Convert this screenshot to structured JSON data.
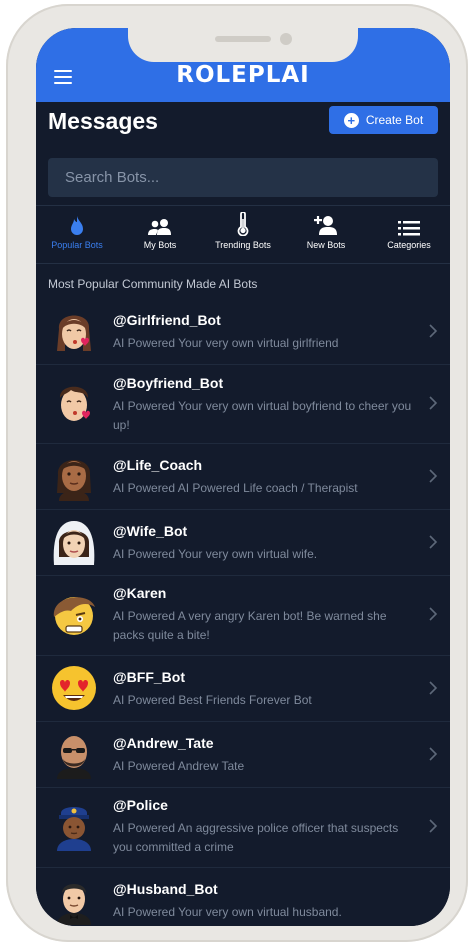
{
  "app": {
    "logo": "ROLEPLAI"
  },
  "header": {
    "title": "Messages",
    "create_label": "Create Bot"
  },
  "search": {
    "placeholder": "Search Bots..."
  },
  "tabs": [
    {
      "label": "Popular Bots",
      "icon": "flame-icon",
      "active": true
    },
    {
      "label": "My Bots",
      "icon": "users-icon",
      "active": false
    },
    {
      "label": "Trending Bots",
      "icon": "thermometer-icon",
      "active": false
    },
    {
      "label": "New Bots",
      "icon": "user-plus-icon",
      "active": false
    },
    {
      "label": "Categories",
      "icon": "list-icon",
      "active": false
    }
  ],
  "section_title": "Most Popular Community Made AI Bots",
  "bots": [
    {
      "name": "@Girlfriend_Bot",
      "description": "AI Powered Your very own virtual girlfriend",
      "avatar": "girl-kiss-emoji"
    },
    {
      "name": "@Boyfriend_Bot",
      "description": "AI Powered Your very own virtual boyfriend to cheer you up!",
      "avatar": "boy-kiss-emoji"
    },
    {
      "name": "@Life_Coach",
      "description": "AI Powered AI Powered Life coach / Therapist",
      "avatar": "woman-emoji"
    },
    {
      "name": "@Wife_Bot",
      "description": "AI Powered Your very own virtual wife.",
      "avatar": "bride-emoji"
    },
    {
      "name": "@Karen",
      "description": "AI Powered A very angry Karen bot! Be warned she packs quite a bite!",
      "avatar": "angry-woman-emoji"
    },
    {
      "name": "@BFF_Bot",
      "description": "AI Powered Best Friends Forever Bot",
      "avatar": "heart-eyes-emoji"
    },
    {
      "name": "@Andrew_Tate",
      "description": "AI Powered Andrew Tate",
      "avatar": "bald-man-emoji"
    },
    {
      "name": "@Police",
      "description": "AI Powered An aggressive police officer that suspects you committed a crime",
      "avatar": "police-officer-emoji"
    },
    {
      "name": "@Husband_Bot",
      "description": "AI Powered Your very own virtual husband.",
      "avatar": "groom-emoji"
    }
  ],
  "colors": {
    "accent": "#2f6fe6",
    "background": "#131b2c",
    "active_tab": "#3a7ff0"
  }
}
